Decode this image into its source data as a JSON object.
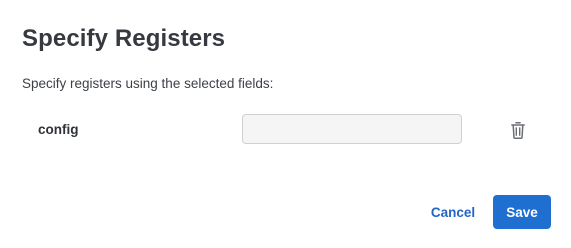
{
  "dialog": {
    "title": "Specify Registers",
    "description": "Specify registers using the selected fields:",
    "fields": [
      {
        "label": "config",
        "value": "",
        "placeholder": "",
        "delete_icon": "trash-icon"
      }
    ],
    "footer": {
      "cancel_label": "Cancel",
      "save_label": "Save"
    }
  },
  "colors": {
    "accent": "#1f6fd1",
    "link": "#2566c4",
    "input_background": "#f5f5f5",
    "input_border": "#cfd1d4",
    "icon": "#6b6f75"
  }
}
